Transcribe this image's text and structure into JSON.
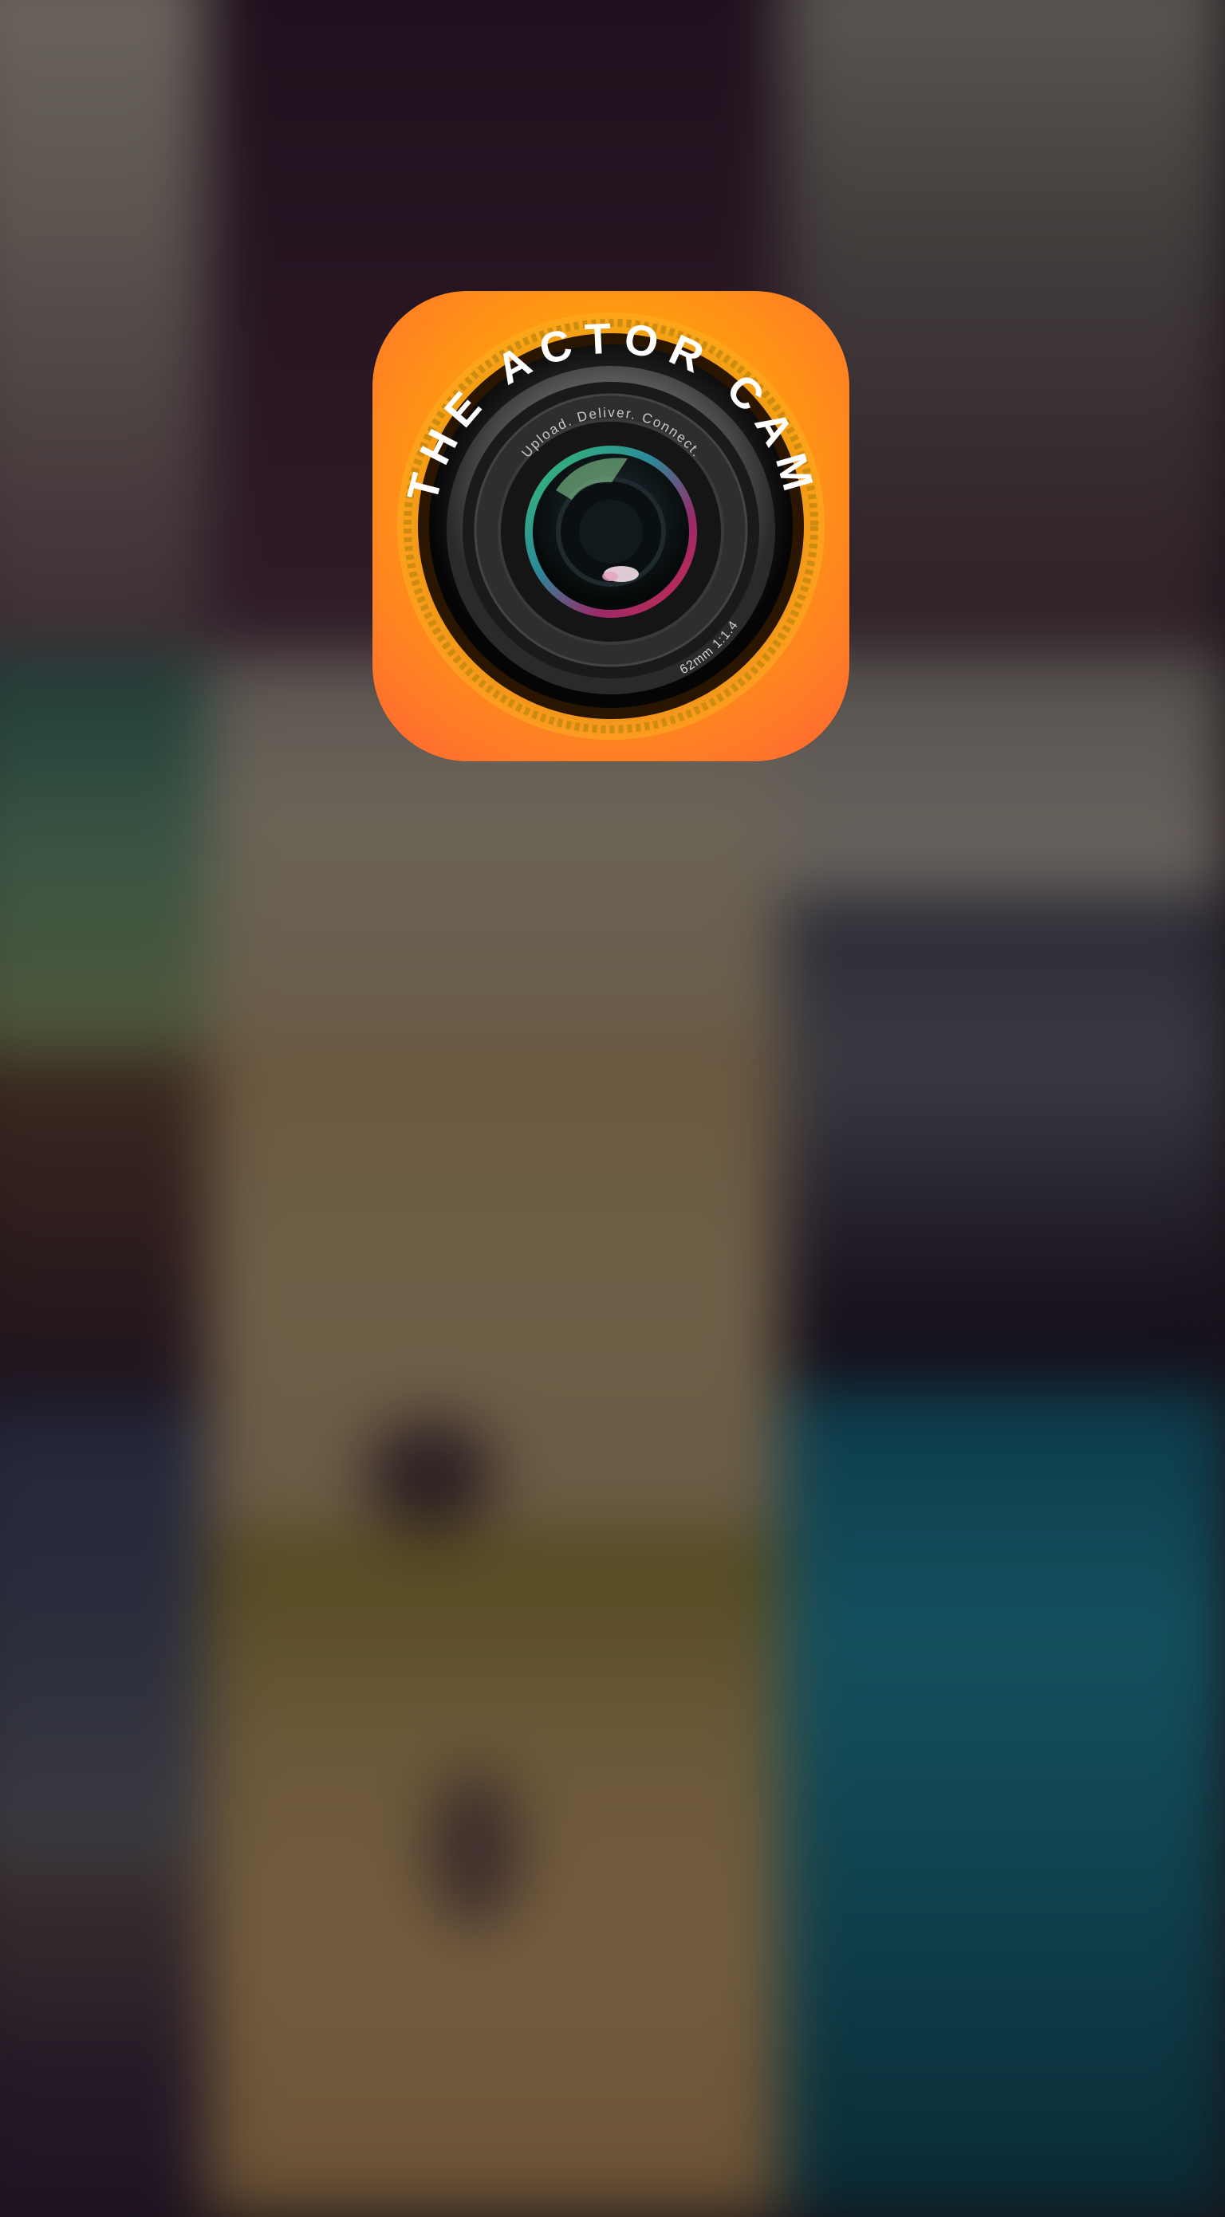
{
  "app": {
    "name": "THE ACTOR CAM",
    "tagline": "Upload. Deliver. Connect.",
    "lens_spec": "62mm 1:1.4",
    "icon_name": "camera-lens-icon",
    "colors": {
      "icon_orange": "#ff9a10",
      "icon_orange_dark": "#ff6436",
      "lens_black": "#111111"
    }
  }
}
